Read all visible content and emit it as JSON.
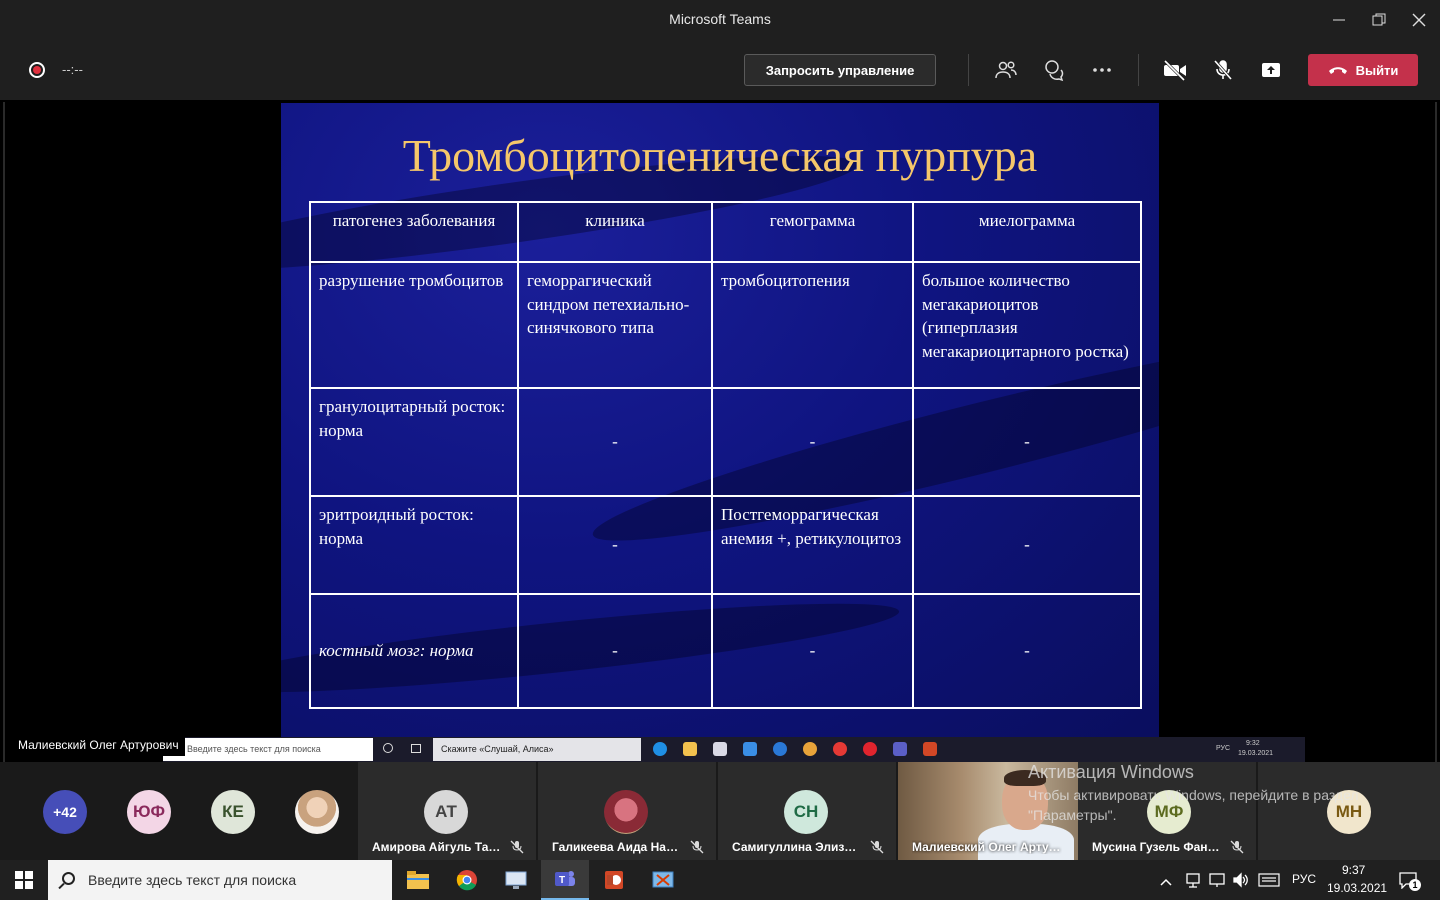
{
  "window": {
    "title": "Microsoft Teams"
  },
  "toolbar": {
    "timer": "--:--",
    "request_control_label": "Запросить управление",
    "leave_label": "Выйти"
  },
  "slide": {
    "title": "Тромбоцитопеническая пурпура",
    "headers": [
      "патогенез заболевания",
      "клиника",
      "гемограмма",
      "миелограмма"
    ],
    "rows": [
      [
        "разрушение тромбоцитов",
        "геморрагический синдром петехиально-синячкового типа",
        "тромбоцитопения",
        "большое количество мегакариоцитов (гиперплазия мегакариоцитарного ростка)"
      ],
      [
        "гранулоцитарный росток: норма",
        "-",
        "-",
        "-"
      ],
      [
        "эритроидный росток: норма",
        "-",
        "Постгеморрагическая анемия +, ретикулоцитоз",
        "-"
      ],
      [
        "костный мозг: норма",
        "-",
        "-",
        "-"
      ]
    ]
  },
  "presenter_label": "Малиевский Олег Артурович",
  "shared_taskbar": {
    "search_placeholder": "Введите здесь текст для поиска",
    "alice_placeholder": "Скажите «Слушай, Алиса»",
    "lang": "РУС",
    "time": "9:32",
    "date": "19.03.2021"
  },
  "participants": {
    "more_count": "+42",
    "small_avatars": [
      {
        "initials": "ЮФ",
        "color": "#f3d6e6",
        "text_color": "#8a2a5c"
      },
      {
        "initials": "КЕ",
        "color": "#dfe6d9",
        "text_color": "#39522d"
      }
    ],
    "tiles": [
      {
        "initials": "АТ",
        "name": "Амирова Айгуль Таги...",
        "color": "#d8d8d8",
        "text_color": "#444"
      },
      {
        "initials": "",
        "name": "Галикеева Аида Нази...",
        "color": "#b54a5a",
        "text_color": "#fff"
      },
      {
        "initials": "СН",
        "name": "Самигуллина Элиза ...",
        "color": "#cfe8dc",
        "text_color": "#1f6b45"
      },
      {
        "initials": "МФ",
        "name": "Мусина Гузель Фанис...",
        "color": "#e6ecd0",
        "text_color": "#5c6b1f"
      },
      {
        "initials": "МН",
        "name": "",
        "color": "#f1e6cc",
        "text_color": "#7a5a12"
      }
    ],
    "video_name": "Малиевский Олег Артуро...",
    "activation_title": "Активация Windows",
    "activation_sub": "Чтобы активировать Windows, перейдите в раздел \"Параметры\"."
  },
  "taskbar": {
    "search_placeholder": "Введите здесь текст для поиска",
    "lang": "РУС",
    "time": "9:37",
    "date": "19.03.2021",
    "notifications": "1"
  },
  "colors": {
    "slide_title": "#f5c76a",
    "leave_button": "#c4314b",
    "teams_purple": "#464eb8"
  }
}
